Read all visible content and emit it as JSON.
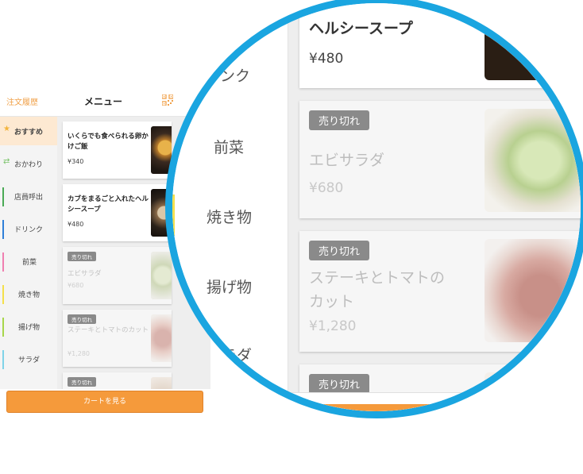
{
  "header": {
    "history_label": "注文履歴",
    "title": "メニュー",
    "qr_icon": "qr-code-icon"
  },
  "sidebar": {
    "items": [
      {
        "label": "おすすめ",
        "icon": "star-icon",
        "color": "#f3b43c",
        "selected": true
      },
      {
        "label": "おかわり",
        "icon": "refresh-icon",
        "color": "#7cc46c",
        "selected": false
      },
      {
        "label": "店員呼出",
        "icon": "",
        "color": "#4aaa55",
        "selected": false
      },
      {
        "label": "ドリンク",
        "icon": "",
        "color": "#2f7fd8",
        "selected": false
      },
      {
        "label": "前菜",
        "icon": "",
        "color": "#f07fb0",
        "selected": false
      },
      {
        "label": "焼き物",
        "icon": "",
        "color": "#f4e04a",
        "selected": false
      },
      {
        "label": "揚げ物",
        "icon": "",
        "color": "#a7d64a",
        "selected": false
      },
      {
        "label": "サラダ",
        "icon": "",
        "color": "#7fd3e8",
        "selected": false
      }
    ]
  },
  "menu_items": [
    {
      "name": "いくらでも食べられる卵かけご飯",
      "price": "¥340",
      "sold_out": false
    },
    {
      "name": "カブをまるごと入れたヘルシースープ",
      "price": "¥480",
      "sold_out": false
    },
    {
      "name": "エビサラダ",
      "price": "¥680",
      "sold_out": true
    },
    {
      "name": "ステーキとトマトのカット",
      "price": "¥1,280",
      "sold_out": true
    },
    {
      "name": "",
      "price": "",
      "sold_out": true
    }
  ],
  "sold_out_label": "売り切れ",
  "cart_button_label": "カートを見る",
  "zoom": {
    "categories": [
      {
        "label": "ドリンク",
        "color": "#2f7fd8"
      },
      {
        "label": "前菜",
        "color": "#f07fb0"
      },
      {
        "label": "焼き物",
        "color": "#f4e04a"
      },
      {
        "label": "揚げ物",
        "color": "#a7d64a"
      },
      {
        "label": "サラダ",
        "color": "#7fd3e8"
      }
    ],
    "soup_name_partial": "ヘルシースープ",
    "soup_price": "¥480",
    "salad_name": "エビサラダ",
    "salad_price": "¥680",
    "steak_name_1": "ステーキとトマトの",
    "steak_name_2": "カット",
    "steak_price": "¥1,280",
    "cart_partial": "カートを見"
  },
  "colors": {
    "accent_orange": "#f59a3b",
    "magnifier_ring": "#1aa5e0",
    "sold_out_badge": "#8a8a8a"
  }
}
